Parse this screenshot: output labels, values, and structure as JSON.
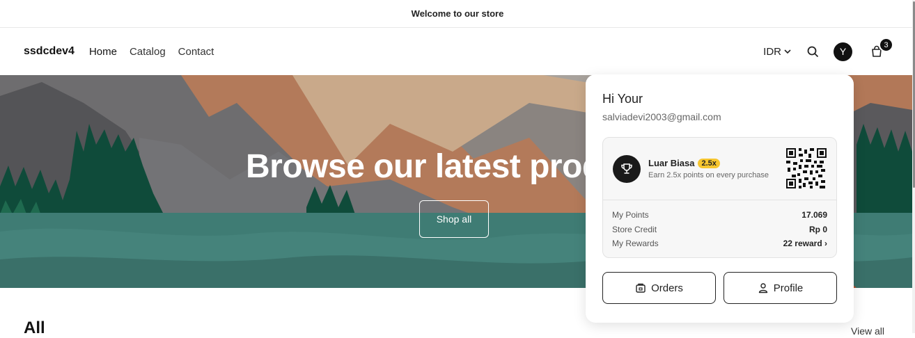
{
  "announcement": {
    "text": "Welcome to our store"
  },
  "header": {
    "logo": "ssdcdev4",
    "nav": [
      {
        "label": "Home"
      },
      {
        "label": "Catalog"
      },
      {
        "label": "Contact"
      }
    ],
    "currency": "IDR",
    "avatar_initial": "Y",
    "cart_count": "3"
  },
  "hero": {
    "title": "Browse our latest products",
    "button": "Shop all"
  },
  "section": {
    "title": "All",
    "view_all": "View all"
  },
  "account_panel": {
    "greeting": "Hi Your",
    "email": "salviadevi2003@gmail.com",
    "tier": {
      "name": "Luar Biasa",
      "multiplier": "2.5x",
      "description": "Earn 2.5x points on every purchase"
    },
    "stats": [
      {
        "label": "My Points",
        "value": "17.069"
      },
      {
        "label": "Store Credit",
        "value": "Rp 0"
      },
      {
        "label": "My Rewards",
        "value": "22 reward ›"
      }
    ],
    "buttons": {
      "orders": "Orders",
      "profile": "Profile"
    }
  },
  "colors": {
    "accent": "#121212",
    "badge": "#f7c62f",
    "hero_water": "#3f7c74",
    "hero_trees": "#0f4b3a"
  }
}
